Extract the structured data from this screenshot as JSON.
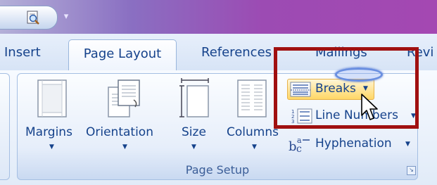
{
  "titlebar": {
    "quick_access_dropdown": "▾"
  },
  "tabs": {
    "insert": "Insert",
    "page_layout": "Page Layout",
    "references": "References",
    "mailings": "Mailings",
    "review_partial": "Revi"
  },
  "page_setup": {
    "group_label": "Page Setup",
    "margins": "Margins",
    "orientation": "Orientation",
    "size": "Size",
    "columns": "Columns",
    "breaks": "Breaks",
    "line_numbers": "Line Numbers",
    "hyphenation": "Hyphenation",
    "dropdown_arrow": "▼"
  },
  "colors": {
    "accent": "#15428b",
    "annotation": "#a01010",
    "highlight": "#ffe497"
  }
}
